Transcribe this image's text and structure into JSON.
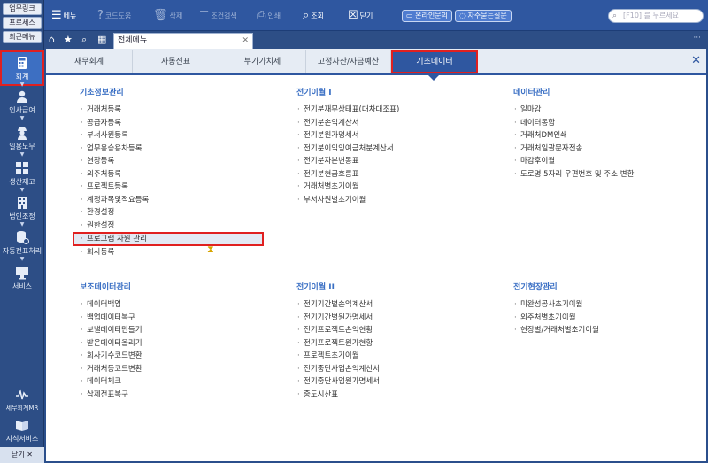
{
  "quick_links": [
    "업무링크",
    "프로세스",
    "최근메뉴"
  ],
  "rail": [
    {
      "name": "accounting",
      "label": "회계"
    },
    {
      "name": "hr",
      "label": "인사급여"
    },
    {
      "name": "daily",
      "label": "일용노무"
    },
    {
      "name": "production",
      "label": "생산재고"
    },
    {
      "name": "corporate",
      "label": "법인조정"
    },
    {
      "name": "auto-slip",
      "label": "자동전표처리"
    },
    {
      "name": "service",
      "label": "서비스"
    },
    {
      "name": "tax-accounting",
      "label": "세무회계MR"
    },
    {
      "name": "knowledge",
      "label": "지식서비스"
    }
  ],
  "rail_close_label": "닫기 ✕",
  "toolbar": {
    "menu": "메뉴",
    "code_help": "코드도움",
    "delete": "삭제",
    "condition_search": "조건검색",
    "print": "인쇄",
    "view": "조회",
    "close": "닫기",
    "online_inquiry": "온라인문의",
    "faq": "자주묻는질문",
    "search_placeholder": "[F10] 를 누르세요"
  },
  "page_tab": "전체메뉴",
  "categories": [
    "재무회계",
    "자동전표",
    "부가가치세",
    "고정자산/자금예산",
    "기초데이터"
  ],
  "active_category": "기초데이터",
  "sections": {
    "basic_info": {
      "title": "기초정보관리",
      "items": [
        "거래처등록",
        "공급자등록",
        "부서사원등록",
        "업무용승용차등록",
        "현장등록",
        "외주처등록",
        "프로젝트등록",
        "계정과목및적요등록",
        "환경설정",
        "권한설정",
        "프로그램 자원 관리",
        "회사등록"
      ]
    },
    "carryover_1": {
      "title": "전기이월 I",
      "items": [
        "전기분재무상태표(대차대조표)",
        "전기분손익계산서",
        "전기분원가명세서",
        "전기분이익잉여금처분계산서",
        "전기분자본변동표",
        "전기분현금흐름표",
        "거래처별초기이월",
        "부서사원별초기이월"
      ]
    },
    "data_management": {
      "title": "데이터관리",
      "items": [
        "일마감",
        "데이터통합",
        "거래처DM인쇄",
        "거래처일괄문자전송",
        "마감후이월",
        "도로명 5자리 우편번호 및 주소 변환"
      ]
    },
    "aux_data": {
      "title": "보조데이터관리",
      "items": [
        "데이터백업",
        "백업데이터복구",
        "보낼데이터만들기",
        "받은데이터올리기",
        "회사기수코드변환",
        "거래처등코드변환",
        "데이터체크",
        "삭제전표복구"
      ]
    },
    "carryover_2": {
      "title": "전기이월 II",
      "items": [
        "전기기간별손익계산서",
        "전기기간별원가명세서",
        "전기프로젝트손익현황",
        "전기프로젝트원가현황",
        "프로젝트초기이월",
        "전기중단사업손익계산서",
        "전기중단사업원가명세서",
        "중도시산표"
      ]
    },
    "site_carryover": {
      "title": "전기현장관리",
      "items": [
        "미완성공사초기이월",
        "외주처별초기이월",
        "현장별/거래처별초기이월"
      ]
    }
  },
  "highlighted_item": "프로그램 자원 관리",
  "colors": {
    "accent": "#2f57a0",
    "highlight_border": "#e02020",
    "section_title": "#3a6fc4"
  }
}
